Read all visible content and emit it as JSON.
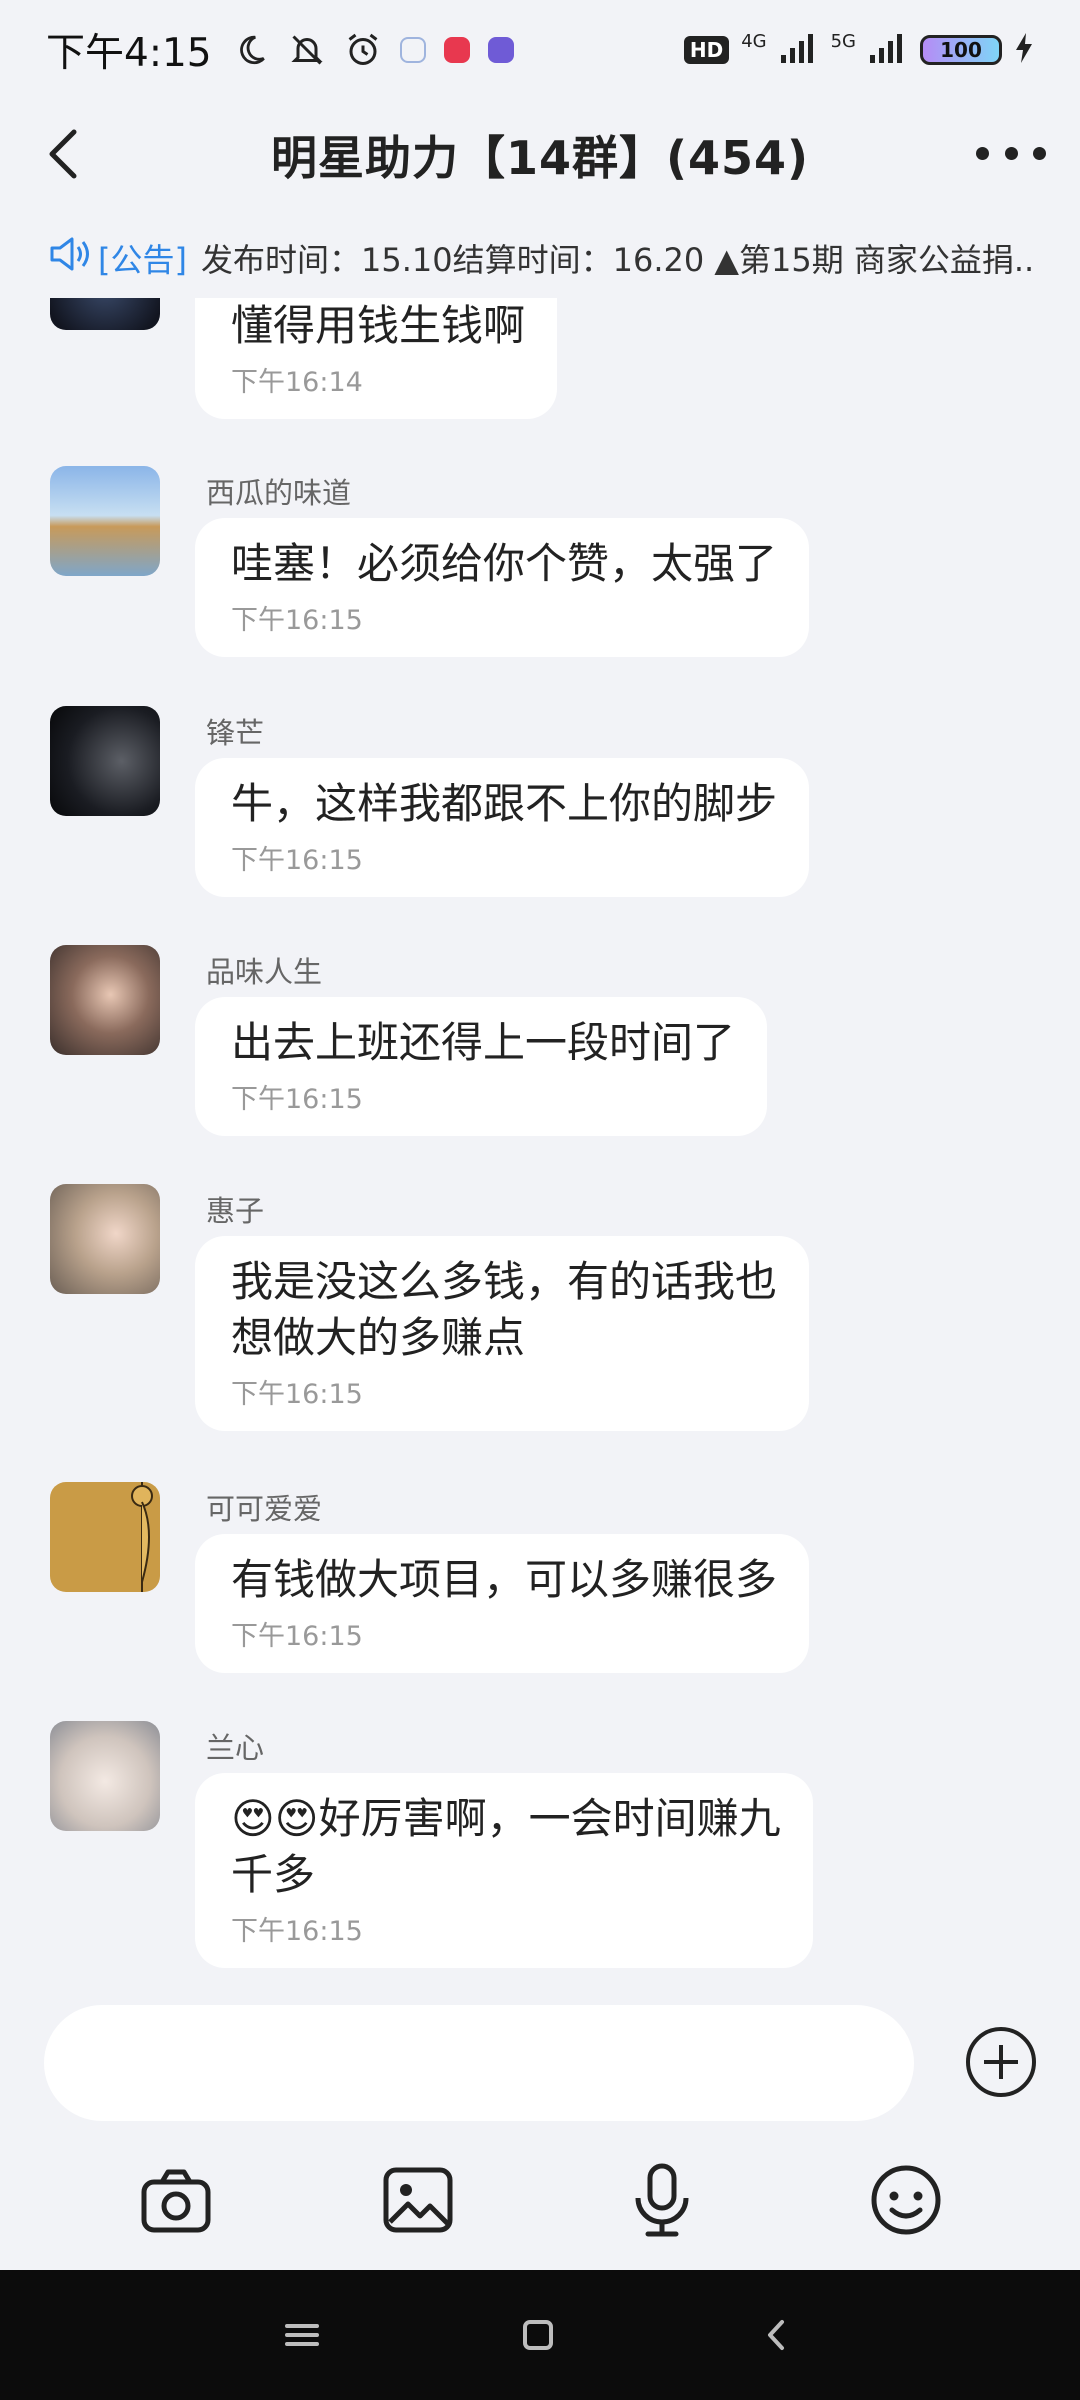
{
  "status": {
    "time": "下午4:15",
    "hd_label": "HD",
    "net1": "4G",
    "net2": "5G",
    "battery": "100"
  },
  "header": {
    "title": "明星助力【14群】(454)"
  },
  "announcement": {
    "tag": "[公告]",
    "text": "发布时间：15.10结算时间：16.20 ▲第15期 商家公益捐.."
  },
  "messages": [
    {
      "sender": "",
      "text": "懂得用钱生钱啊",
      "time": "下午16:14"
    },
    {
      "sender": "西瓜的味道",
      "text": "哇塞！必须给你个赞，太强了",
      "time": "下午16:15"
    },
    {
      "sender": "锋芒",
      "text": "牛，这样我都跟不上你的脚步",
      "time": "下午16:15"
    },
    {
      "sender": "品味人生",
      "text": "出去上班还得上一段时间了",
      "time": "下午16:15"
    },
    {
      "sender": "惠子",
      "text": "我是没这么多钱，有的话我也\n想做大的多赚点",
      "time": "下午16:15"
    },
    {
      "sender": "可可爱爱",
      "text": "有钱做大项目，可以多赚很多",
      "time": "下午16:15"
    },
    {
      "sender": "兰心",
      "text": "😍😍好厉害啊，一会时间赚九\n千多",
      "time": "下午16:15"
    }
  ],
  "composer": {
    "placeholder": ""
  },
  "icons": {
    "back": "back-arrow-icon",
    "more": "more-dots-icon",
    "speaker": "speaker-icon",
    "plus": "plus-circle-icon",
    "camera": "camera-icon",
    "image": "image-icon",
    "mic": "microphone-icon",
    "emoji": "emoji-icon"
  },
  "colors": {
    "background": "#f2f3f7",
    "bubble": "#ffffff",
    "accent": "#2f86e6",
    "navbar": "#0c0c0c"
  }
}
